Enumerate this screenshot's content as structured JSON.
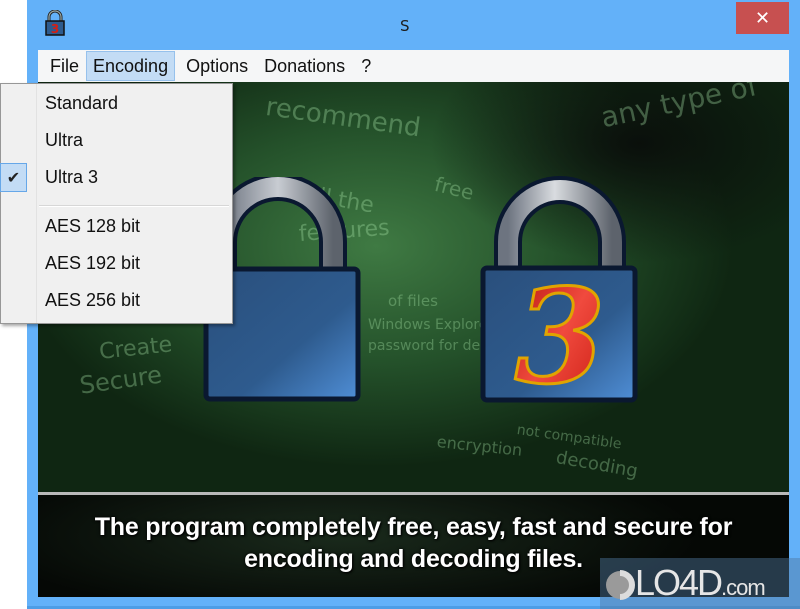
{
  "window": {
    "title": "S",
    "close_label": "✕"
  },
  "menubar": {
    "items": [
      {
        "label": "File"
      },
      {
        "label": "Encoding",
        "active": true
      },
      {
        "label": "Options"
      },
      {
        "label": "Donations"
      },
      {
        "label": "?"
      }
    ]
  },
  "encoding_menu": {
    "items": [
      {
        "label": "Standard",
        "checked": false
      },
      {
        "label": "Ultra",
        "checked": false
      },
      {
        "label": "Ultra 3",
        "checked": true
      },
      {
        "label": "AES 128 bit",
        "checked": false
      },
      {
        "label": "AES 192 bit",
        "checked": false
      },
      {
        "label": "AES 256 bit",
        "checked": false
      }
    ],
    "check_glyph": "✔"
  },
  "banner": {
    "lock_number": "3",
    "caption_line1": "The program completely free, easy, fast and secure for",
    "caption_line2": "encoding and decoding files.",
    "background_words": [
      "recommend",
      "any type of",
      "all the",
      "features",
      "of files",
      "Windows Explorer",
      "password for decoding",
      "Create",
      "Secure",
      "not compatible",
      "decoding",
      "free",
      "encryption"
    ]
  },
  "watermark": {
    "brand": "LO4D",
    "suffix": ".com"
  },
  "colors": {
    "titlebar": "#63b1f9",
    "close_button": "#c75050",
    "menu_highlight": "#c3dcf5",
    "lock_body": "#2e5b8e",
    "number_red": "#d81e12"
  }
}
